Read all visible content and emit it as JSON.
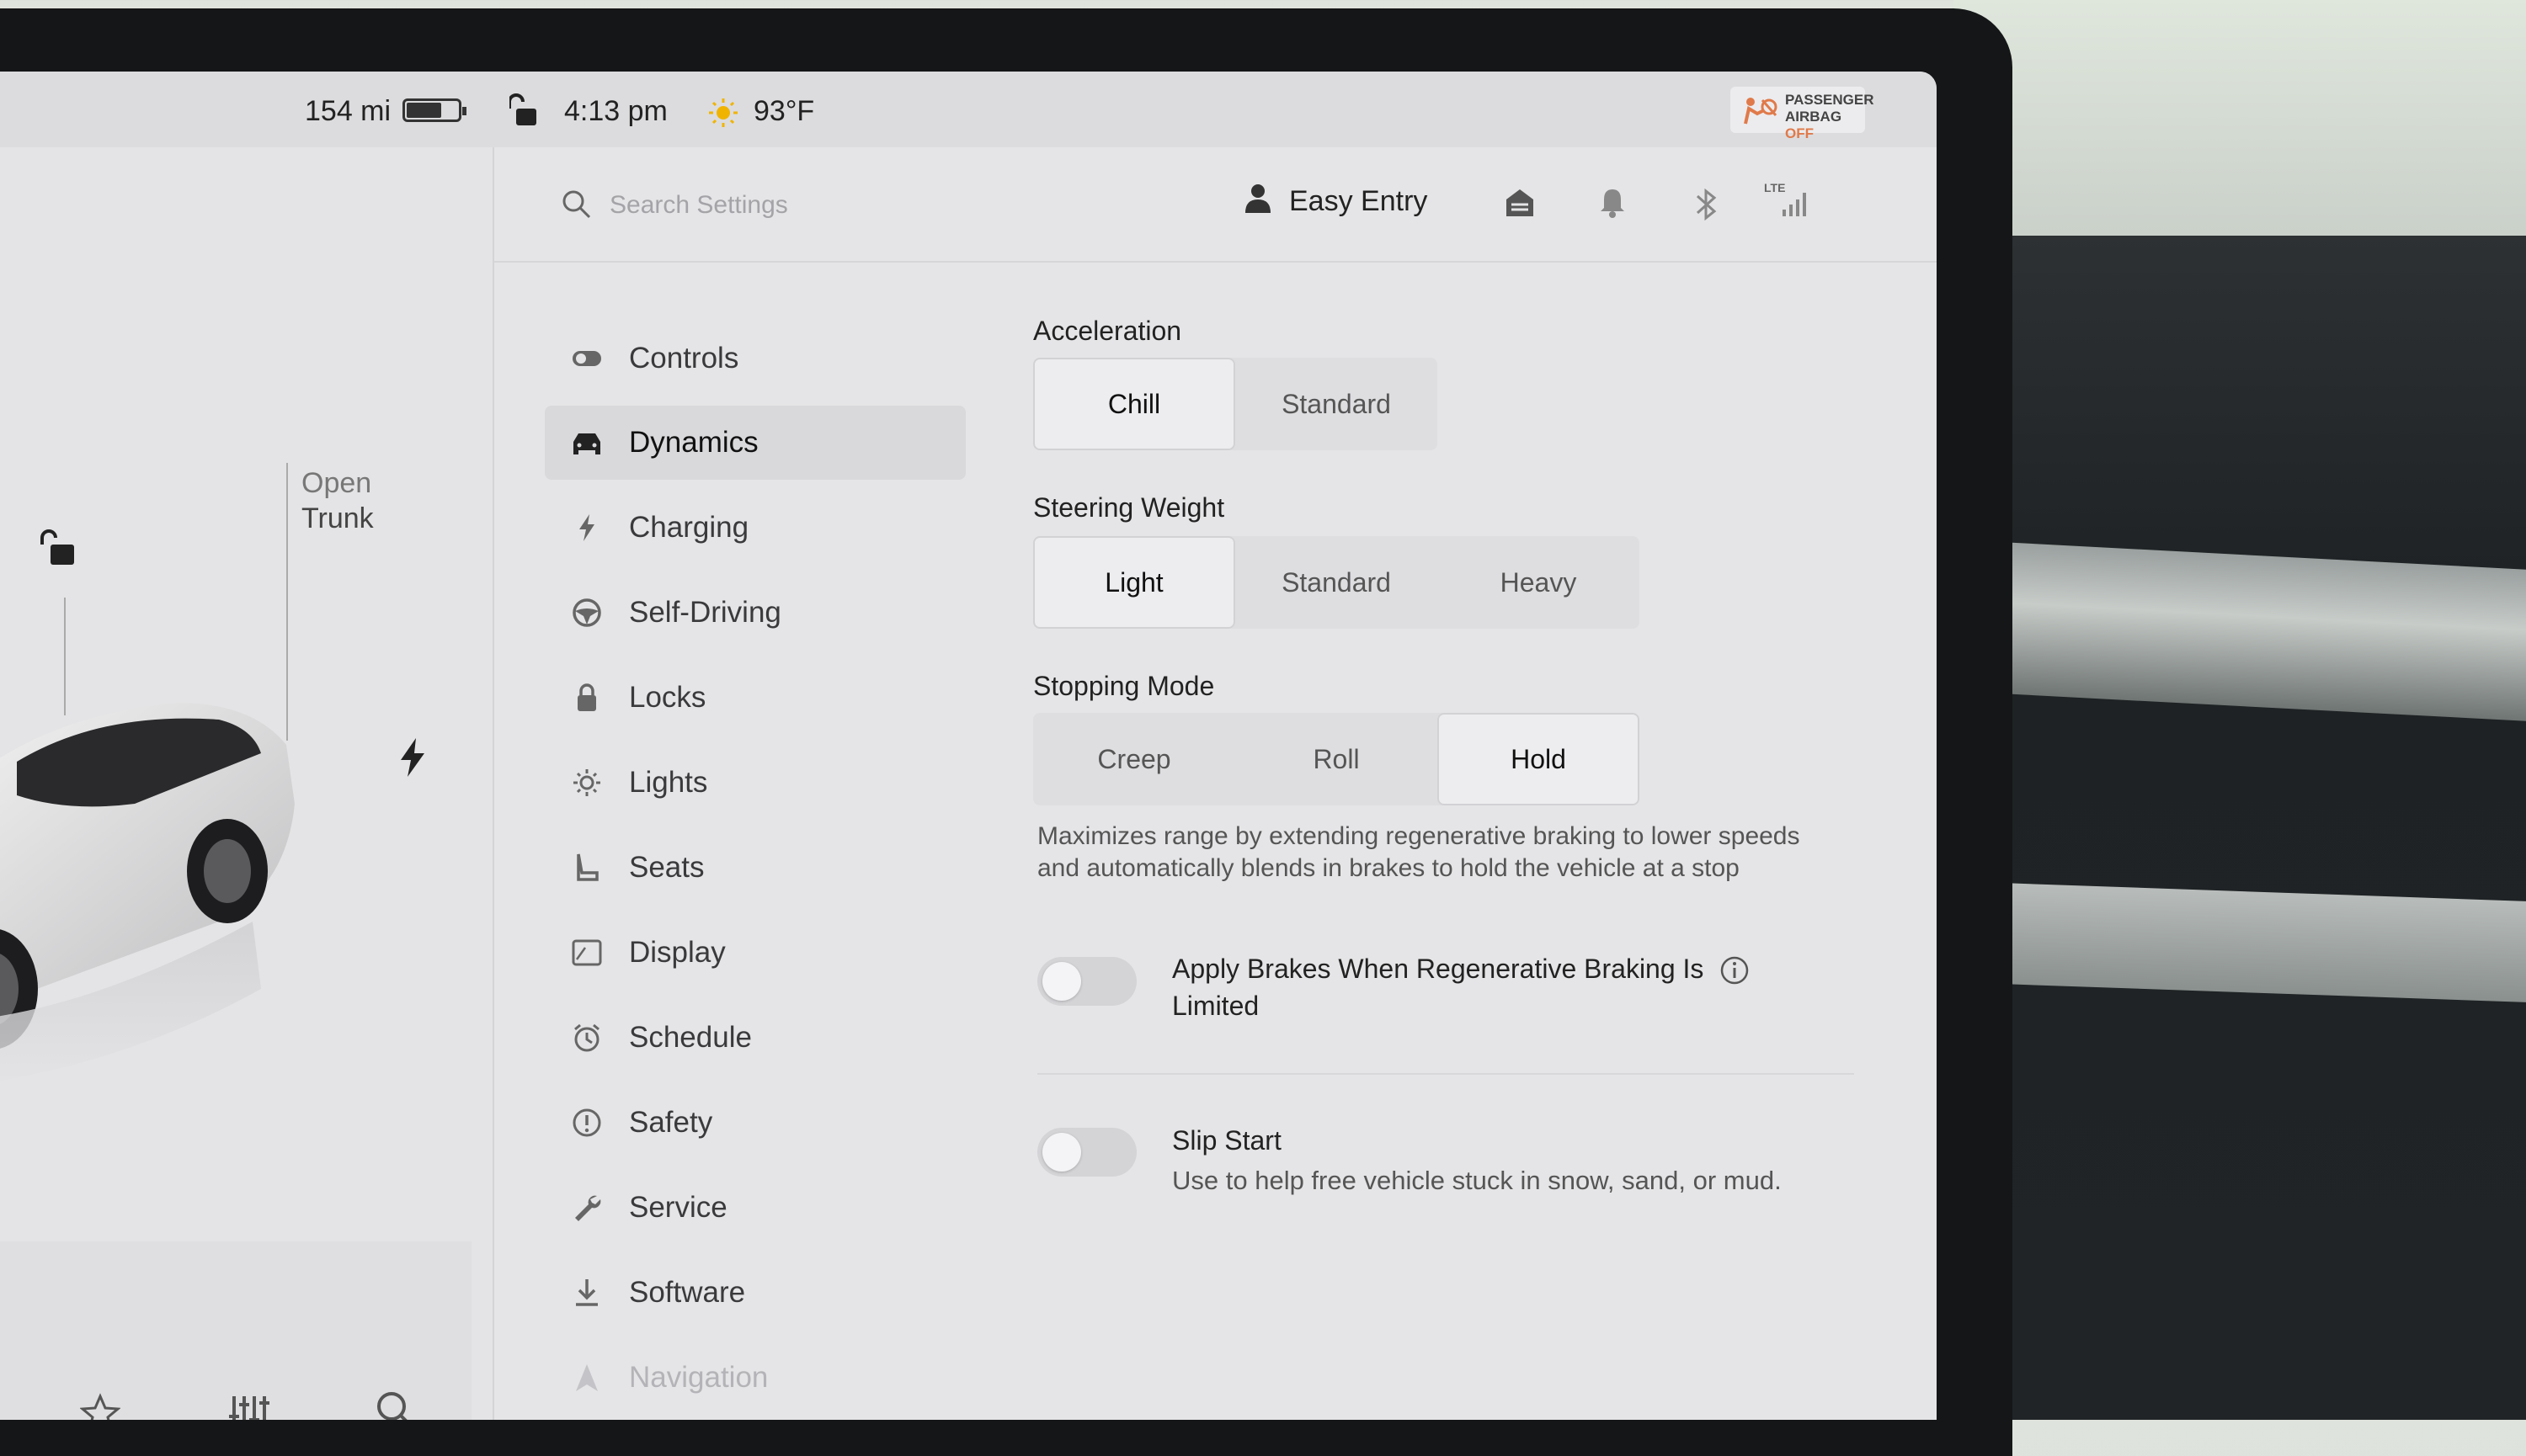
{
  "status": {
    "range": "154 mi",
    "battery_fraction": 0.7,
    "time": "4:13 pm",
    "temperature": "93°F",
    "airbag_label": "PASSENGER",
    "airbag_sub": "AIRBAG",
    "airbag_state": "OFF"
  },
  "car": {
    "open_label": "Open",
    "trunk_label": "Trunk"
  },
  "header": {
    "search_placeholder": "Search Settings",
    "profile_name": "Easy Entry",
    "lte_label": "LTE"
  },
  "nav": {
    "items": [
      {
        "label": "Controls",
        "icon": "toggle-icon"
      },
      {
        "label": "Dynamics",
        "icon": "car-icon",
        "active": true
      },
      {
        "label": "Charging",
        "icon": "bolt-icon"
      },
      {
        "label": "Self-Driving",
        "icon": "steering-wheel-icon"
      },
      {
        "label": "Locks",
        "icon": "lock-icon"
      },
      {
        "label": "Lights",
        "icon": "sun-icon"
      },
      {
        "label": "Seats",
        "icon": "seat-icon"
      },
      {
        "label": "Display",
        "icon": "display-icon"
      },
      {
        "label": "Schedule",
        "icon": "alarm-clock-icon"
      },
      {
        "label": "Safety",
        "icon": "alert-circle-icon"
      },
      {
        "label": "Service",
        "icon": "wrench-icon"
      },
      {
        "label": "Software",
        "icon": "download-icon"
      },
      {
        "label": "Navigation",
        "icon": "navigation-arrow-icon"
      }
    ]
  },
  "dynamics": {
    "acceleration": {
      "title": "Acceleration",
      "options": [
        "Chill",
        "Standard"
      ],
      "selected": "Chill"
    },
    "steering": {
      "title": "Steering Weight",
      "options": [
        "Light",
        "Standard",
        "Heavy"
      ],
      "selected": "Light"
    },
    "stopping": {
      "title": "Stopping Mode",
      "options": [
        "Creep",
        "Roll",
        "Hold"
      ],
      "selected": "Hold",
      "description": "Maximizes range by extending regenerative braking to lower speeds and automatically blends in brakes to hold the vehicle at a stop"
    },
    "apply_brakes": {
      "label": "Apply Brakes When Regenerative Braking Is Limited",
      "enabled": false
    },
    "slip_start": {
      "label": "Slip Start",
      "description": "Use to help free vehicle stuck in snow, sand, or mud.",
      "enabled": false
    }
  }
}
